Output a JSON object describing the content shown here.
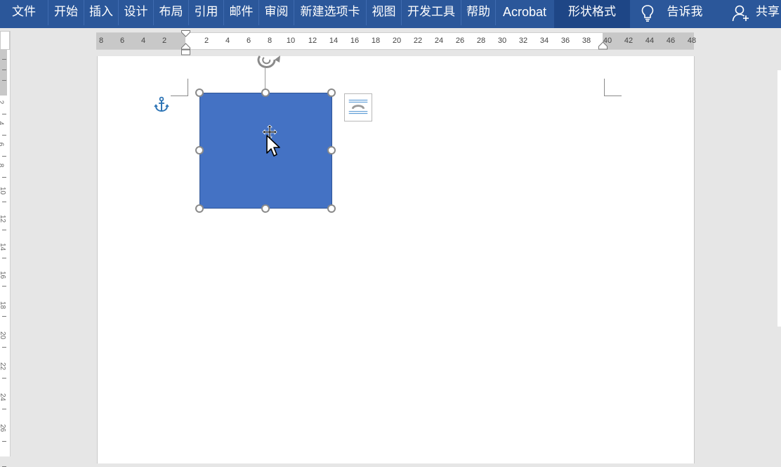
{
  "ribbon": {
    "tabs": [
      {
        "label": "文件"
      },
      {
        "label": "开始"
      },
      {
        "label": "插入"
      },
      {
        "label": "设计"
      },
      {
        "label": "布局"
      },
      {
        "label": "引用"
      },
      {
        "label": "邮件"
      },
      {
        "label": "审阅"
      },
      {
        "label": "新建选项卡"
      },
      {
        "label": "视图"
      },
      {
        "label": "开发工具"
      },
      {
        "label": "帮助"
      },
      {
        "label": "Acrobat"
      }
    ],
    "context_tab": "形状格式",
    "tell_me": "告诉我",
    "share": "共享"
  },
  "ruler": {
    "left_numbers": [
      "8",
      "6",
      "4",
      "2"
    ],
    "right_numbers": [
      "2",
      "4",
      "6",
      "8",
      "10",
      "12",
      "14",
      "16",
      "18",
      "20",
      "22",
      "24",
      "26",
      "28",
      "30",
      "32",
      "34",
      "36",
      "38",
      "40",
      "42",
      "44",
      "46",
      "48"
    ]
  },
  "vertical_ruler": {
    "numbers": [
      "2",
      "4",
      "6",
      "8",
      "10",
      "12",
      "14",
      "16",
      "18",
      "20",
      "22",
      "24",
      "26"
    ]
  },
  "document": {
    "shape_fill": "#4472c4",
    "shape_type": "rectangle",
    "selected": true
  },
  "colors": {
    "ribbon": "#2b579a",
    "context_tab": "#1e4686"
  }
}
